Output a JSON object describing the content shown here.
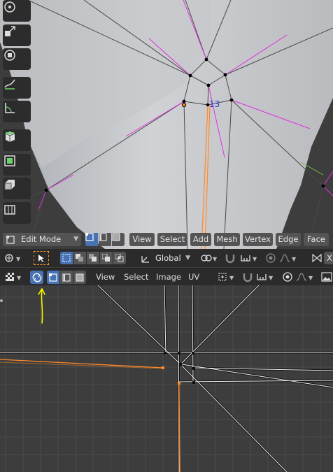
{
  "viewport": {
    "vertex_label": "13",
    "mode": {
      "selected": "Edit Mode"
    },
    "menus": [
      "View",
      "Select",
      "Add",
      "Mesh",
      "Vertex",
      "Edge",
      "Face"
    ]
  },
  "tool_header": {
    "orientation": "Global",
    "cut_letter": "X"
  },
  "uv_header": {
    "menus": [
      "View",
      "Select",
      "Image",
      "UV"
    ]
  },
  "annotation": {
    "color": "#f5f500"
  },
  "colors": {
    "accent": "#4772b3",
    "wire_selected": "#ff8a2a",
    "normal_lines": "#e030e0",
    "header_bg": "#2b2b2b",
    "button_bg": "#545454"
  }
}
